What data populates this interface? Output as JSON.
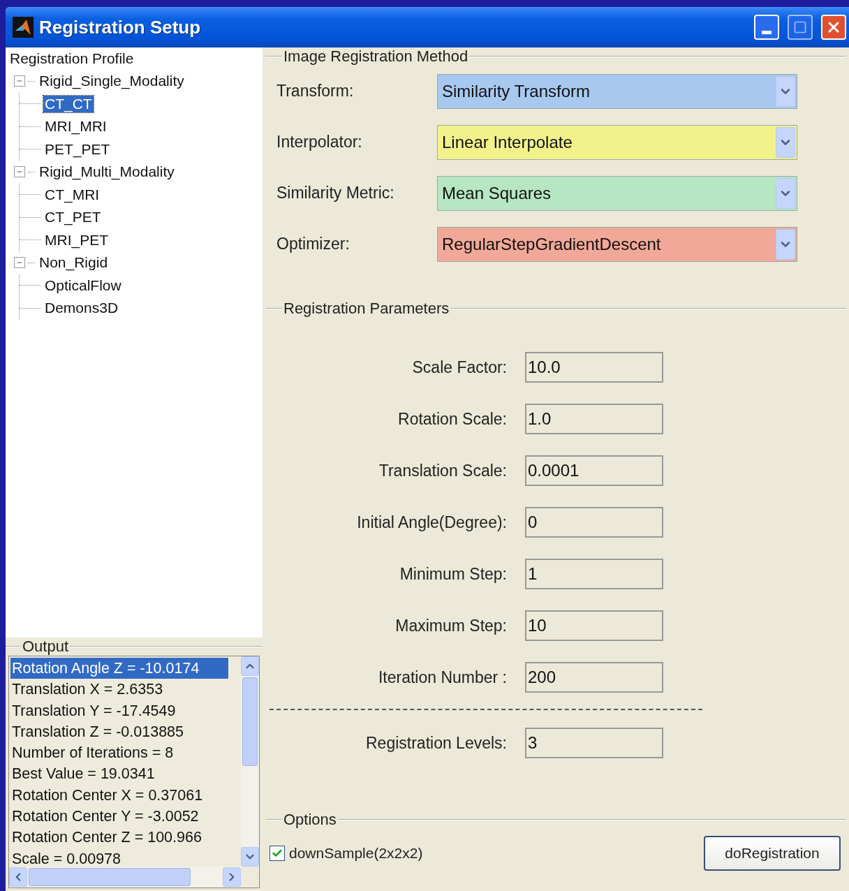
{
  "window": {
    "title": "Registration Setup"
  },
  "profile_tree": {
    "title": "Registration Profile",
    "items": [
      {
        "label": "Rigid_Single_Modality",
        "expanded": true,
        "selected": false,
        "children": [
          {
            "label": "CT_CT",
            "selected": true
          },
          {
            "label": "MRI_MRI",
            "selected": false
          },
          {
            "label": "PET_PET",
            "selected": false
          }
        ]
      },
      {
        "label": "Rigid_Multi_Modality",
        "expanded": true,
        "selected": false,
        "children": [
          {
            "label": "CT_MRI",
            "selected": false
          },
          {
            "label": "CT_PET",
            "selected": false
          },
          {
            "label": "MRI_PET",
            "selected": false
          }
        ]
      },
      {
        "label": "Non_Rigid",
        "expanded": true,
        "selected": false,
        "children": [
          {
            "label": "OpticalFlow",
            "selected": false
          },
          {
            "label": "Demons3D",
            "selected": false
          }
        ]
      }
    ]
  },
  "output": {
    "title": "Output",
    "lines": [
      {
        "text": "Rotation Angle Z = -10.0174",
        "selected": true
      },
      {
        "text": "Translation X = 2.6353",
        "selected": false
      },
      {
        "text": "Translation Y = -17.4549",
        "selected": false
      },
      {
        "text": "Translation Z = -0.013885",
        "selected": false
      },
      {
        "text": "Number of Iterations = 8",
        "selected": false
      },
      {
        "text": "Best Value = 19.0341",
        "selected": false
      },
      {
        "text": "Rotation Center X = 0.37061",
        "selected": false
      },
      {
        "text": "Rotation Center Y = -3.0052",
        "selected": false
      },
      {
        "text": "Rotation Center Z = 100.966",
        "selected": false
      },
      {
        "text": "Scale = 0.00978",
        "selected": false
      }
    ]
  },
  "method": {
    "title": "Image Registration Method",
    "rows": [
      {
        "label": "Transform:",
        "value": "Similarity Transform",
        "color": "#a8c8f0"
      },
      {
        "label": "Interpolator:",
        "value": "Linear Interpolate",
        "color": "#f2f28c"
      },
      {
        "label": "Similarity Metric:",
        "value": "Mean Squares",
        "color": "#b6e6c2"
      },
      {
        "label": "Optimizer:",
        "value": "RegularStepGradientDescent",
        "color": "#f2a898"
      }
    ]
  },
  "parameters": {
    "title": "Registration Parameters",
    "fields": [
      {
        "label": "Scale Factor:",
        "value": "10.0"
      },
      {
        "label": "Rotation Scale:",
        "value": "1.0"
      },
      {
        "label": "Translation Scale:",
        "value": "0.0001"
      },
      {
        "label": "Initial Angle(Degree):",
        "value": "0"
      },
      {
        "label": "Minimum Step:",
        "value": "1"
      },
      {
        "label": "Maximum Step:",
        "value": "10"
      },
      {
        "label": "Iteration Number :",
        "value": "200"
      }
    ],
    "levels": {
      "label": "Registration Levels:",
      "value": "3"
    }
  },
  "options": {
    "title": "Options",
    "checkbox": {
      "label": "downSample(2x2x2)",
      "checked": true
    },
    "button": "doRegistration"
  }
}
